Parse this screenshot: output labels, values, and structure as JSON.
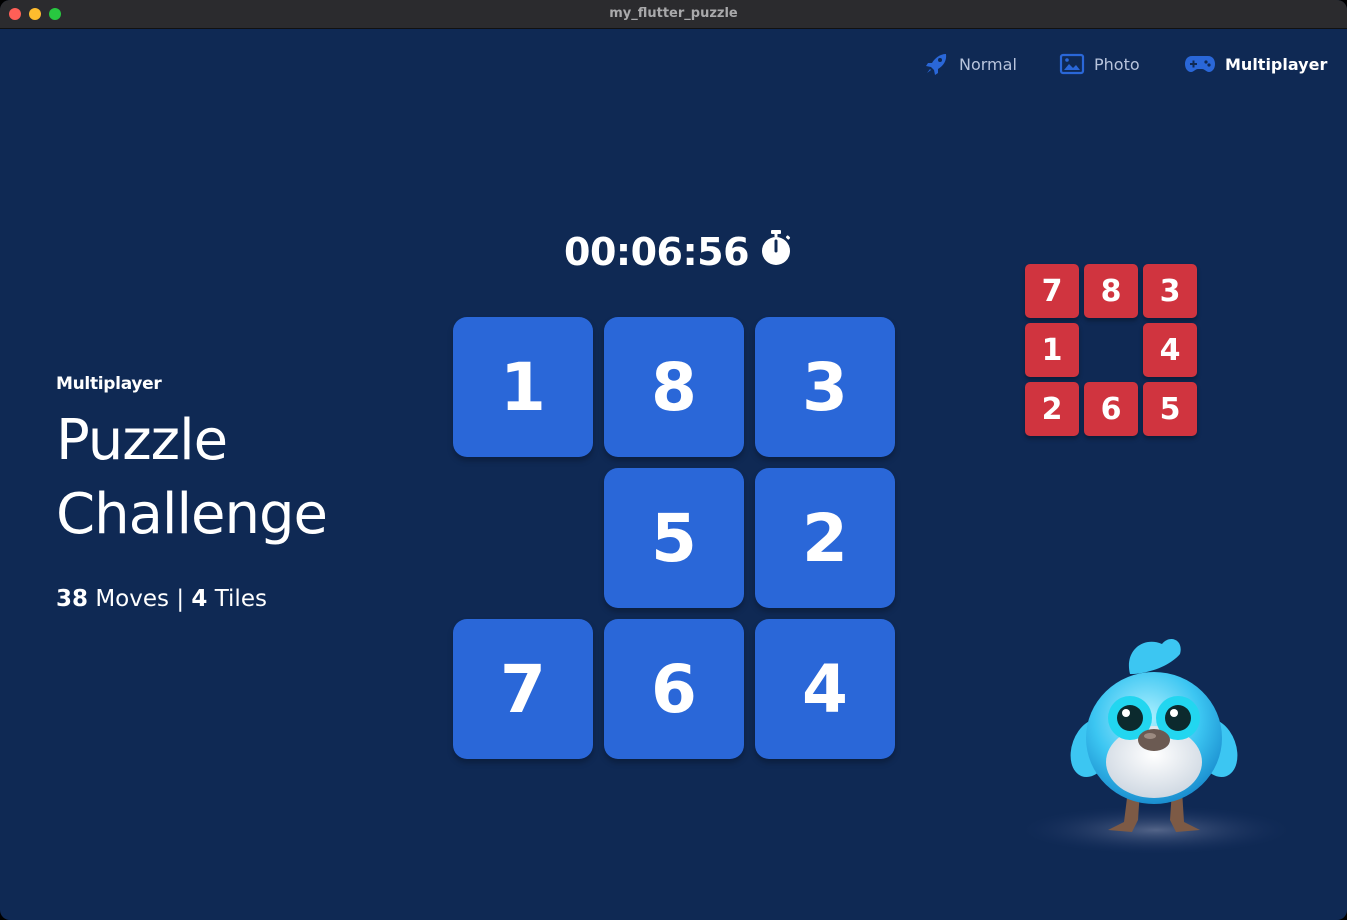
{
  "window": {
    "title": "my_flutter_puzzle"
  },
  "nav": {
    "normal": {
      "label": "Normal",
      "icon": "rocket-icon"
    },
    "photo": {
      "label": "Photo",
      "icon": "image-icon"
    },
    "multiplayer": {
      "label": "Multiplayer",
      "icon": "gamepad-icon"
    }
  },
  "header": {
    "mode_label": "Multiplayer",
    "title_line1": "Puzzle",
    "title_line2": "Challenge"
  },
  "stats": {
    "moves": "38",
    "moves_label": "Moves",
    "separator": "|",
    "tiles": "4",
    "tiles_label": "Tiles"
  },
  "timer": {
    "value": "00:06:56",
    "icon": "stopwatch-icon"
  },
  "board": {
    "rows": [
      [
        "1",
        "8",
        "3"
      ],
      [
        "",
        "5",
        "2"
      ],
      [
        "7",
        "6",
        "4"
      ]
    ]
  },
  "opponent_board": {
    "rows": [
      [
        "7",
        "8",
        "3"
      ],
      [
        "1",
        "",
        "4"
      ],
      [
        "2",
        "6",
        "5"
      ]
    ]
  },
  "colors": {
    "background": "#0f2954",
    "player_tile": "#2a67d8",
    "opponent_tile": "#d0343f",
    "active_nav": "#ffffff",
    "inactive_nav": "#b8c4dc",
    "accent_icon": "#2a67d8"
  }
}
